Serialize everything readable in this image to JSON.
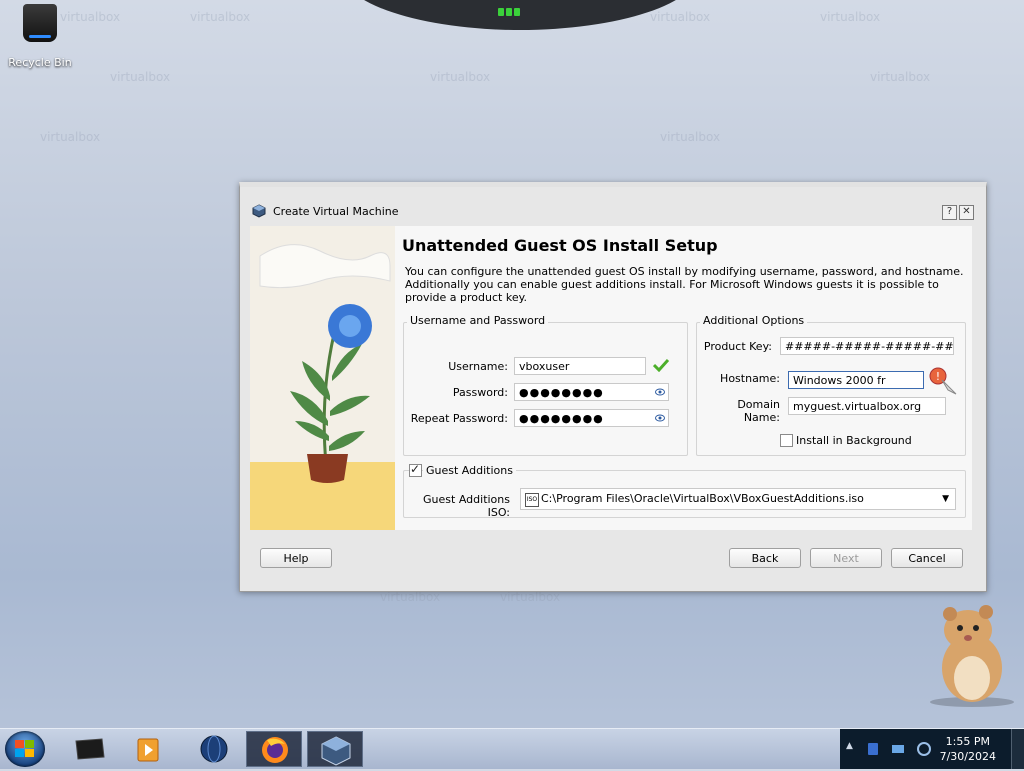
{
  "desktop": {
    "recycle_bin_label": "Recycle Bin"
  },
  "dialog": {
    "title": "Create Virtual Machine",
    "help_button": "?",
    "close_button": "✕",
    "heading": "Unattended Guest OS Install Setup",
    "description": "You can configure the unattended guest OS install by modifying username, password, and hostname. Additionally you can enable guest additions install. For Microsoft Windows guests it is possible to provide a product key.",
    "username_group": {
      "title": "Username and Password",
      "username_label": "Username:",
      "username_value": "vboxuser",
      "password_label": "Password:",
      "password_value": "●●●●●●●●",
      "repeat_password_label": "Repeat Password:",
      "repeat_password_value": "●●●●●●●●"
    },
    "additional_options": {
      "title": "Additional Options",
      "product_key_label": "Product Key:",
      "product_key_value": "#####-#####-#####-#####",
      "hostname_label": "Hostname:",
      "hostname_value": "Windows 2000 fr",
      "domain_name_label": "Domain Name:",
      "domain_name_value": "myguest.virtualbox.org",
      "install_background_label": "Install in Background",
      "install_background_checked": false
    },
    "guest_additions": {
      "label": "Guest Additions",
      "checked": true,
      "iso_label": "Guest Additions ISO:",
      "iso_value": "C:\\Program Files\\Oracle\\VirtualBox\\VBoxGuestAdditions.iso",
      "disc_icon_text": "ISO"
    },
    "buttons": {
      "help": "Help",
      "back": "Back",
      "next": "Next",
      "cancel": "Cancel"
    }
  },
  "taskbar": {
    "items": [
      "terminal-icon",
      "media-player-icon",
      "globe-icon",
      "firefox-icon",
      "virtualbox-icon"
    ],
    "clock_time": "1:55 PM",
    "clock_date": "7/30/2024",
    "tray_expand": "▲"
  },
  "colors": {
    "accent_blue": "#3c6bb0",
    "check_green": "#4caf2a",
    "taskbar_dark": "#0c1c2c"
  }
}
